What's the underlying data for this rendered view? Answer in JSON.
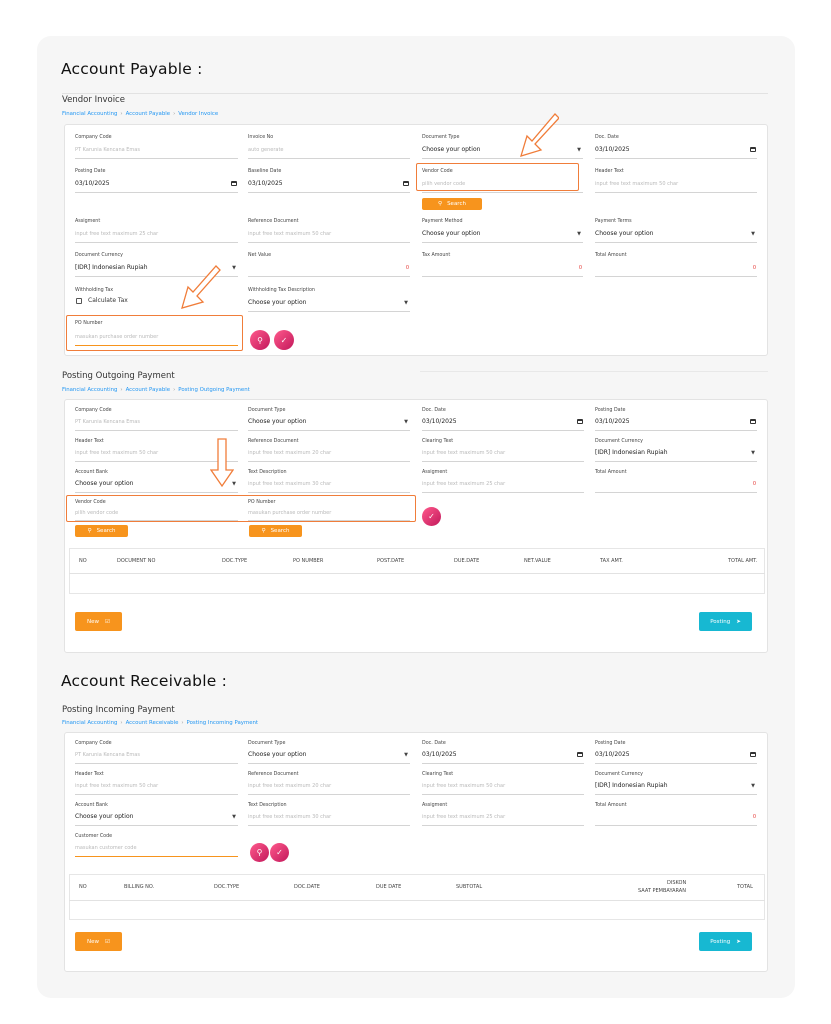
{
  "colors": {
    "accent": "#f7941d",
    "link": "#2196f3",
    "teal": "#17b8d2",
    "pink": "#e91e63",
    "highlight": "#f07d3a"
  },
  "ap": {
    "title": "Account Payable :",
    "vendor_invoice": {
      "title": "Vendor Invoice",
      "breadcrumb": [
        "Financial Accounting",
        "Account Payable",
        "Vendor Invoice"
      ],
      "company_code": {
        "label": "Company Code",
        "value": "PT Karunia Kencana Emas"
      },
      "invoice_no": {
        "label": "Invoice No",
        "placeholder": "auto generate"
      },
      "document_type": {
        "label": "Document Type",
        "value": "Choose your option"
      },
      "doc_date": {
        "label": "Doc. Date",
        "value": "03/10/2025"
      },
      "posting_date": {
        "label": "Posting Date",
        "value": "03/10/2025"
      },
      "baseline_date": {
        "label": "Baseline Date",
        "value": "03/10/2025"
      },
      "vendor_code": {
        "label": "Vendor Code",
        "placeholder": "pilih vendor code"
      },
      "header_text": {
        "label": "Header Text",
        "placeholder": "input free text maximum 50 char"
      },
      "search_label": "Search",
      "assignment": {
        "label": "Assigment",
        "placeholder": "input free text maximum 25 char"
      },
      "reference_document": {
        "label": "Reference Document",
        "placeholder": "input free text maximum 50 char"
      },
      "payment_method": {
        "label": "Payment Method",
        "value": "Choose your option"
      },
      "payment_terms": {
        "label": "Payment Terms",
        "value": "Choose your option"
      },
      "document_currency": {
        "label": "Document Currency",
        "value": "[IDR] Indonesian Rupiah"
      },
      "net_value": {
        "label": "Net Value",
        "value": "0"
      },
      "tax_amount": {
        "label": "Tax Amount",
        "value": "0"
      },
      "total_amount": {
        "label": "Total Amount",
        "value": "0"
      },
      "withholding_tax": {
        "label": "Withholding Tax",
        "checkbox_label": "Calculate Tax"
      },
      "withholding_tax_desc": {
        "label": "Withholding Tax Description",
        "value": "Choose your option"
      },
      "po_number": {
        "label": "PO Number",
        "placeholder": "masukan purchase order number"
      }
    },
    "outgoing": {
      "title": "Posting Outgoing Payment",
      "breadcrumb": [
        "Financial Accounting",
        "Account Payable",
        "Posting Outgoing Payment"
      ],
      "company_code": {
        "label": "Company Code",
        "value": "PT Karunia Kencana Emas"
      },
      "document_type": {
        "label": "Document Type",
        "value": "Choose your option"
      },
      "doc_date": {
        "label": "Doc. Date",
        "value": "03/10/2025"
      },
      "posting_date": {
        "label": "Posting Date",
        "value": "03/10/2025"
      },
      "header_text": {
        "label": "Header Text",
        "placeholder": "input free text maximum 50 char"
      },
      "reference_document": {
        "label": "Reference Document",
        "placeholder": "input free text maximum 20 char"
      },
      "clearing_text": {
        "label": "Clearing Text",
        "placeholder": "input free text maximum 50 char"
      },
      "document_currency": {
        "label": "Document Currency",
        "value": "[IDR] Indonesian Rupiah"
      },
      "account_bank": {
        "label": "Account Bank",
        "value": "Choose your option"
      },
      "text_description": {
        "label": "Text Description",
        "placeholder": "input free text maximum 30 char"
      },
      "assignment": {
        "label": "Assigment",
        "placeholder": "input free text maximum 25 char"
      },
      "total_amount": {
        "label": "Total Amount",
        "value": "0"
      },
      "vendor_code": {
        "label": "Vendor Code",
        "placeholder": "pilih vendor code"
      },
      "po_number": {
        "label": "PO Number",
        "placeholder": "masukan purchase order number"
      },
      "search_label": "Search",
      "columns": [
        "NO",
        "DOCUMENT NO",
        "DOC.TYPE",
        "PO NUMBER",
        "POST.DATE",
        "DUE.DATE",
        "NET.VALUE",
        "TAX AMT.",
        "TOTAL AMT."
      ],
      "new_label": "New",
      "posting_label": "Posting"
    }
  },
  "ar": {
    "title": "Account Receivable :",
    "incoming": {
      "title": "Posting Incoming Payment",
      "breadcrumb": [
        "Financial Accounting",
        "Account Receivable",
        "Posting Incoming Payment"
      ],
      "company_code": {
        "label": "Company Code",
        "value": "PT Karunia Kencana Emas"
      },
      "document_type": {
        "label": "Document Type",
        "value": "Choose your option"
      },
      "doc_date": {
        "label": "Doc. Date",
        "value": "03/10/2025"
      },
      "posting_date": {
        "label": "Posting Date",
        "value": "03/10/2025"
      },
      "header_text": {
        "label": "Header Text",
        "placeholder": "input free text maximum 50 char"
      },
      "reference_document": {
        "label": "Reference Document",
        "placeholder": "input free text maximum 20 char"
      },
      "clearing_text": {
        "label": "Clearing Text",
        "placeholder": "input free text maximum 50 char"
      },
      "document_currency": {
        "label": "Document Currency",
        "value": "[IDR] Indonesian Rupiah"
      },
      "account_bank": {
        "label": "Account Bank",
        "value": "Choose your option"
      },
      "text_description": {
        "label": "Text Description",
        "placeholder": "input free text maximum 30 char"
      },
      "assignment": {
        "label": "Assigment",
        "placeholder": "input free text maximum 25 char"
      },
      "total_amount": {
        "label": "Total Amount",
        "value": "0"
      },
      "customer_code": {
        "label": "Customer Code",
        "placeholder": "masukan customer code"
      },
      "columns": [
        "NO",
        "BILLING NO.",
        "DOC.TYPE",
        "DOC.DATE",
        "DUE DATE",
        "SUBTOTAL",
        "DISKON",
        "SAAT PEMBAYARAN",
        "TOTAL"
      ],
      "new_label": "New",
      "posting_label": "Posting"
    }
  }
}
